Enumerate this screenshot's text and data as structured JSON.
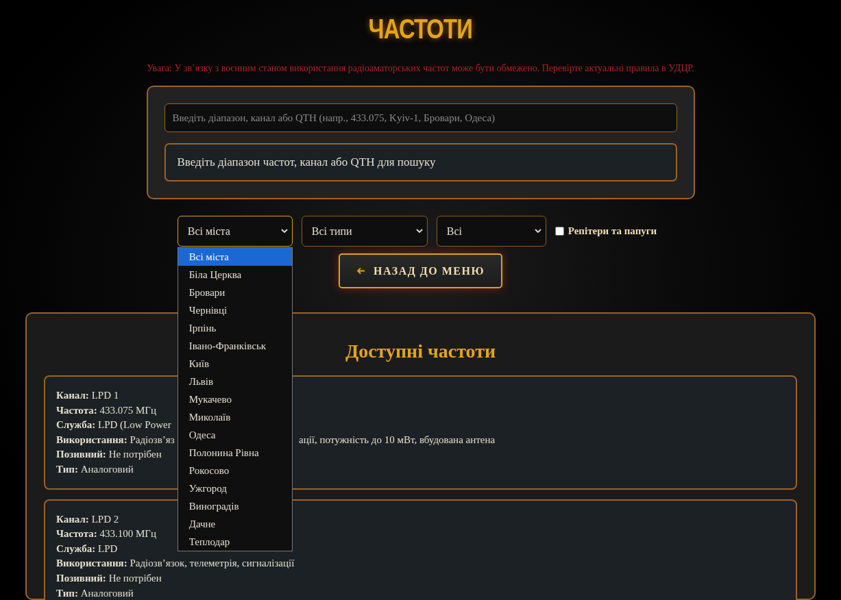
{
  "title": "ЧАСТОТИ",
  "warning": "Увага: У зв’язку з воєнним станом використання радіоаматорських частот може бути обмежено. Перевірте актуальні правила в УДЦР.",
  "search": {
    "placeholder": "Введіть діапазон, канал або QTH (напр., 433.075, Kyiv-1, Бровари, Одеса)"
  },
  "hint": "Введіть діапазон частот, канал або QTH для пошуку",
  "filters": [
    {
      "value": "Всі міста",
      "open": true,
      "options": [
        {
          "label": "Всі міста",
          "selected": true
        },
        {
          "label": "Біла Церква",
          "selected": false
        },
        {
          "label": "Бровари",
          "selected": false
        },
        {
          "label": "Чернівці",
          "selected": false
        },
        {
          "label": "Ірпінь",
          "selected": false
        },
        {
          "label": "Івано-Франківськ",
          "selected": false
        },
        {
          "label": "Київ",
          "selected": false
        },
        {
          "label": "Львів",
          "selected": false
        },
        {
          "label": "Мукачево",
          "selected": false
        },
        {
          "label": "Миколаїв",
          "selected": false
        },
        {
          "label": "Одеса",
          "selected": false
        },
        {
          "label": "Полонина Рівна",
          "selected": false
        },
        {
          "label": "Рокосово",
          "selected": false
        },
        {
          "label": "Ужгород",
          "selected": false
        },
        {
          "label": "Виноградів",
          "selected": false
        },
        {
          "label": "Дачне",
          "selected": false
        },
        {
          "label": "Теплодар",
          "selected": false
        }
      ]
    },
    {
      "value": "Всі типи",
      "open": false
    },
    {
      "value": "Всі",
      "open": false
    }
  ],
  "repeaters": {
    "label": "Репітери та папуги",
    "checked": false
  },
  "back_button": {
    "label": "НАЗАД ДО МЕНЮ"
  },
  "results": {
    "heading": "Доступні частоти",
    "cards": [
      {
        "fields": [
          {
            "label": "Канал:",
            "value": "LPD 1"
          },
          {
            "label": "Частота:",
            "value": "433.075 МГц"
          },
          {
            "label": "Служба:",
            "value": "LPD (Low Power"
          },
          {
            "label": "Використання:",
            "value": "Радіозв’яз",
            "value_tail": "ації, потужність до 10 мВт, вбудована антена"
          },
          {
            "label": "Позивний:",
            "value": "Не потрібен"
          },
          {
            "label": "Тип:",
            "value": "Аналоговий"
          }
        ]
      },
      {
        "fields": [
          {
            "label": "Канал:",
            "value": "LPD 2"
          },
          {
            "label": "Частота:",
            "value": "433.100 МГц"
          },
          {
            "label": "Служба:",
            "value": "LPD"
          },
          {
            "label": "Використання:",
            "value": "Радіозв’язок, телеметрія, сигналізації"
          },
          {
            "label": "Позивний:",
            "value": "Не потрібен"
          },
          {
            "label": "Тип:",
            "value": "Аналоговий"
          }
        ]
      }
    ]
  }
}
